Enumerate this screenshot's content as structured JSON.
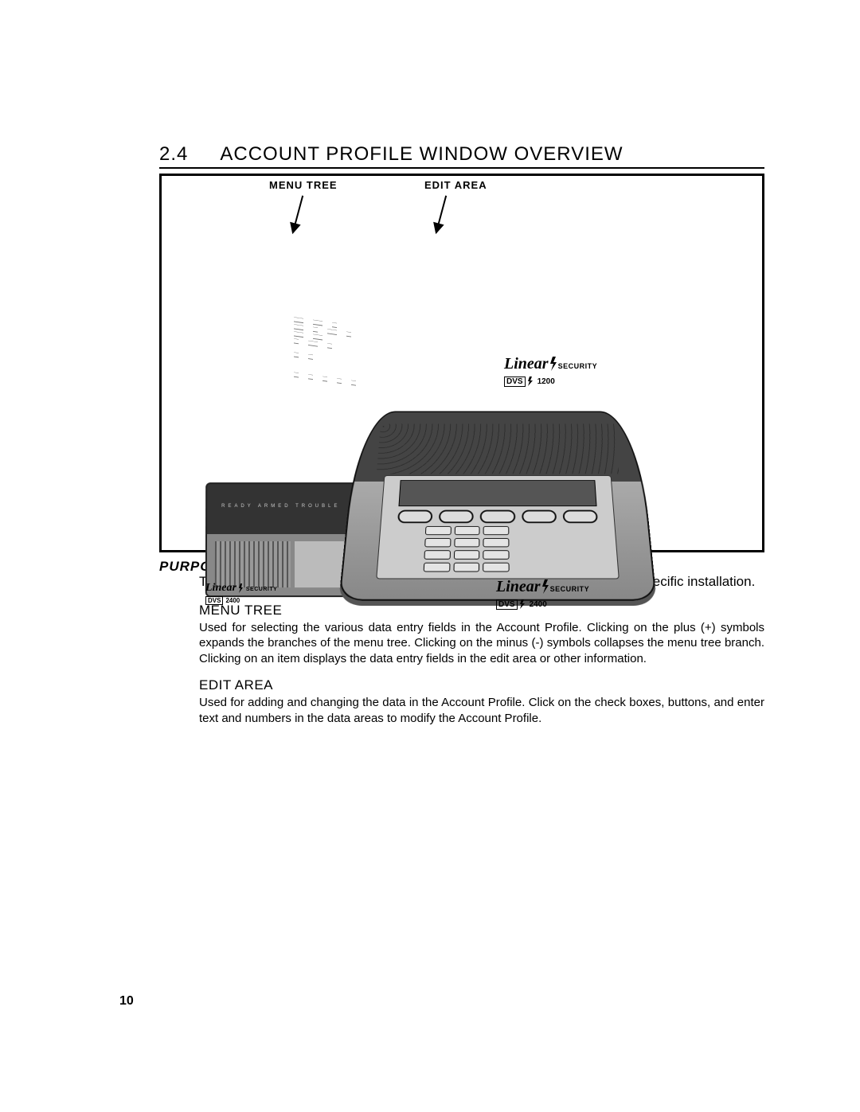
{
  "section_number": "2.4",
  "section_title": "ACCOUNT PROFILE WINDOW OVERVIEW",
  "figure": {
    "menu_tree_label": "MENU TREE",
    "edit_area_label": "EDIT AREA",
    "brand_word": "Linear",
    "brand_security": "SECURITY",
    "model_prefix": "DVS",
    "model_1200": "1200",
    "model_2400": "2400",
    "device_small_leds": "READY   ARMED   TROUBLE"
  },
  "purpose_label": "PURPOSE:",
  "purpose_text": "To enter data or make changes to an Account Profile to customize it for a specific installation.",
  "menu_tree_head": "MENU TREE",
  "menu_tree_body": "Used for selecting the various data entry fields in the Account Profile. Clicking on the plus (+) symbols expands the branches of the menu tree. Clicking on the minus (-) symbols collapses the menu tree branch. Clicking on an item displays the data entry fields in the edit area or other information.",
  "edit_area_head": "EDIT AREA",
  "edit_area_body": "Used for adding and changing the data in the Account Profile. Click on the check boxes, buttons, and enter text and numbers in the data areas to modify the Account Profile.",
  "page_number": "10"
}
